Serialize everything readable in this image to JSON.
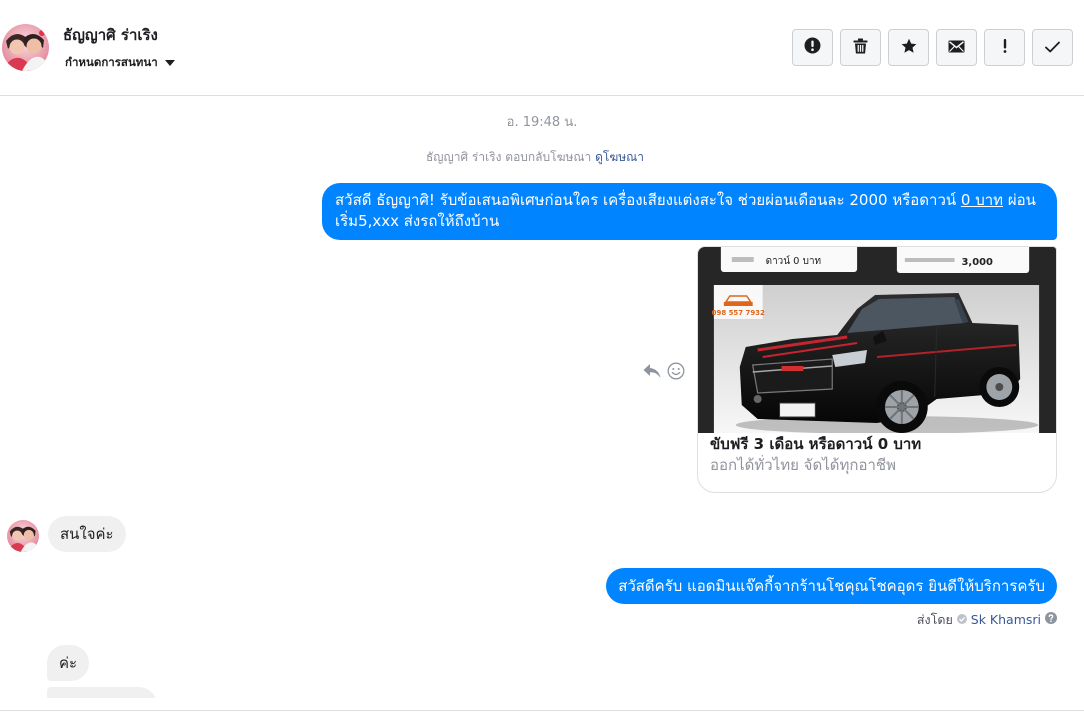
{
  "colors": {
    "outgoing_bubble": "#0084ff",
    "incoming_bubble": "#f1f0f0",
    "meta_text": "#90949c",
    "link": "#385898"
  },
  "header": {
    "contact_name": "ธัญญาศิ ร่าเริง",
    "conversation_menu_label": "กำหนดการสนทนา",
    "actions": [
      "exclamation-circle-icon",
      "trash-icon",
      "star-icon",
      "envelope-icon",
      "exclamation-icon",
      "checkmark-icon"
    ]
  },
  "conversation": {
    "timestamp": "อ. 19:48 น.",
    "ad_reply_text": "ธัญญาศิ ร่าเริง ตอบกลับโฆษณา",
    "ad_reply_link": "ดูโฆษณา",
    "messages": [
      {
        "direction": "outgoing",
        "segments": [
          {
            "text": "สวัสดี ธัญญาศิ! รับข้อเสนอพิเศษก่อนใคร เครื่องเสียงแต่งสะใจ ช่วยผ่อนเดือนละ 2000 หรือดาวน์ "
          },
          {
            "text": "0 บาท",
            "underline": true
          },
          {
            "text": " ผ่อนเริ่ม5,xxx ส่งรถให้ถึงบ้าน"
          }
        ]
      },
      {
        "direction": "outgoing",
        "type": "ad_card",
        "image_text": [
          "ดาวน์ 0 บาท",
          "3,000",
          "098 557 7932"
        ],
        "title": "ขับฟรี 3 เดือน หรือดาวน์ 0 บาท",
        "subtitle": "ออกได้ทั่วไทย จัดได้ทุกอาชีพ",
        "hover_actions": [
          "reply-icon",
          "smiley-icon"
        ]
      },
      {
        "direction": "incoming",
        "text": "สนใจค่ะ"
      },
      {
        "direction": "outgoing",
        "text": "สวัสดีครับ แอดมินแจ๊คกี้จากร้านโชคุณโชคอุดร ยินดีให้บริการครับ"
      },
      {
        "direction": "incoming",
        "text": "ค่ะ"
      },
      {
        "direction": "incoming"
      }
    ],
    "sent_by": {
      "label": "ส่งโดย",
      "name": "Sk Khamsri"
    }
  }
}
